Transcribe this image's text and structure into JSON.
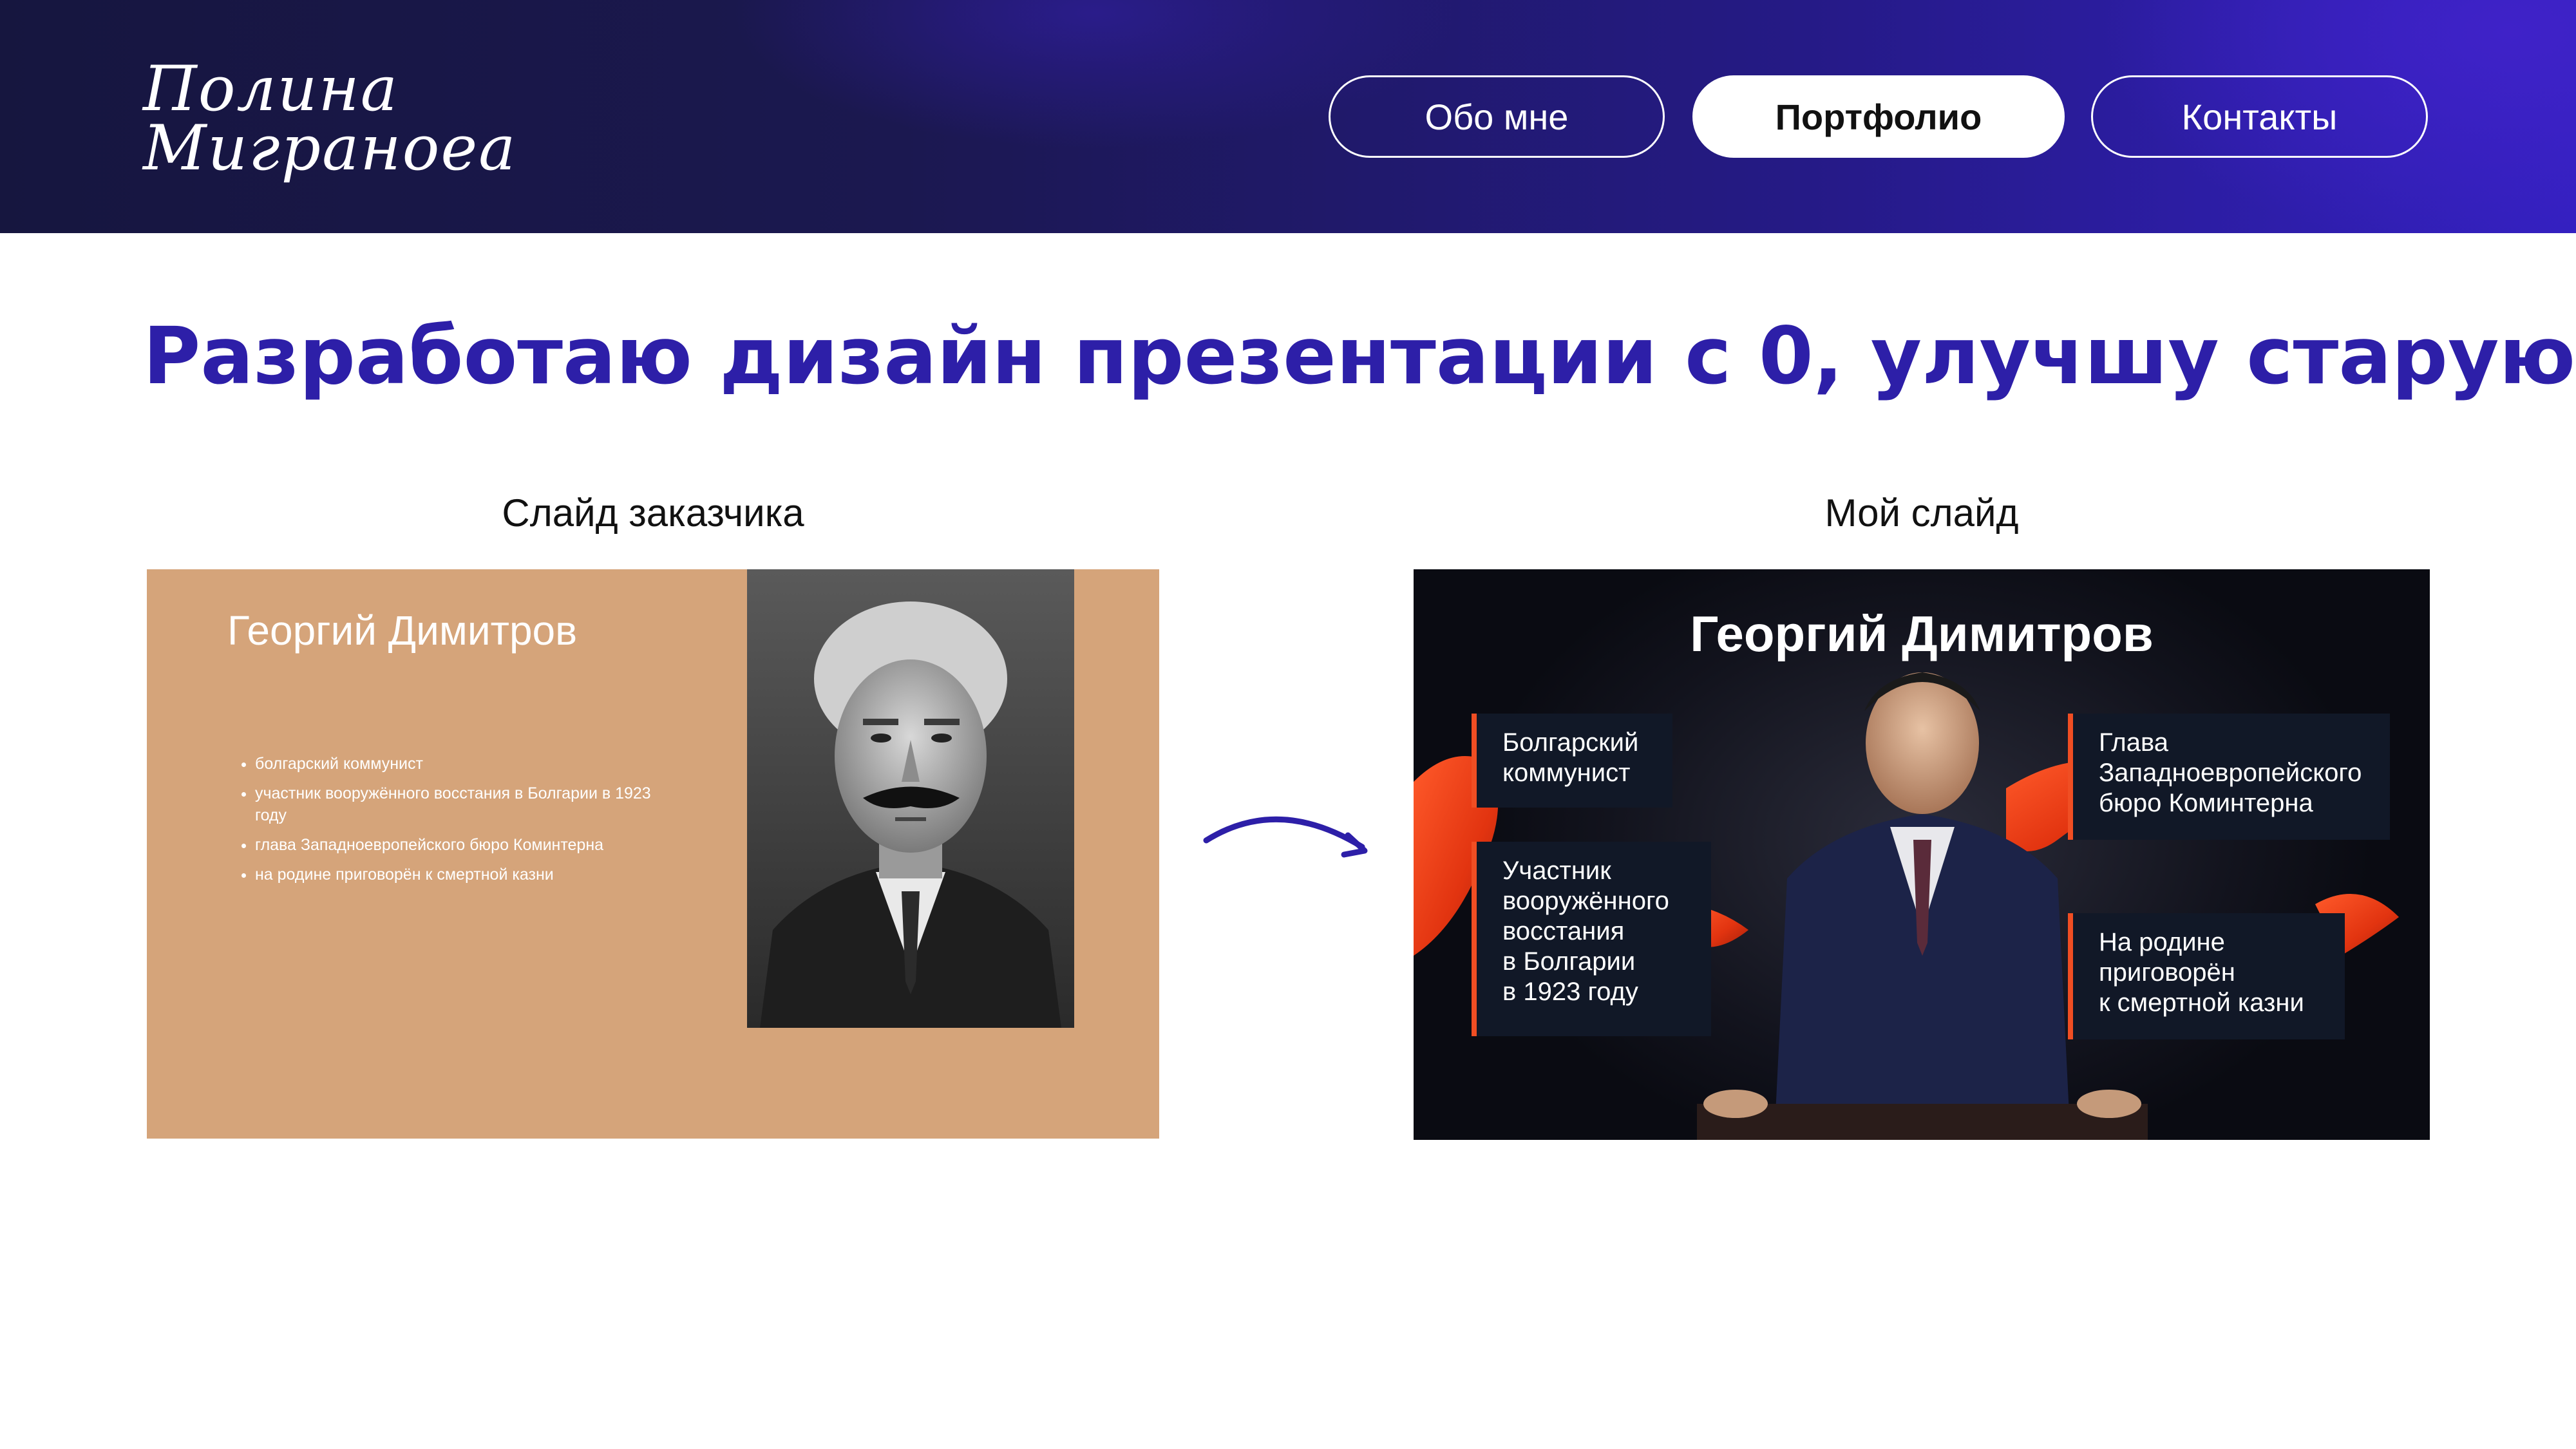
{
  "header": {
    "logo_line1": "Полина",
    "logo_line2": "Миграноеа",
    "nav": {
      "about": "Обо мне",
      "portfolio": "Портфолио",
      "contacts": "Контакты"
    },
    "active_nav": "portfolio"
  },
  "main": {
    "title": "Разработаю дизайн презентации с 0, улучшу старую",
    "caption_left": "Слайд заказчика",
    "caption_right": "Мой слайд"
  },
  "old_slide": {
    "title": "Георгий Димитров",
    "bullets": [
      "болгарский коммунист",
      "участник вооружённого восстания в Болгарии в 1923 году",
      "глава Западноевропейского бюро Коминтерна",
      "на родине приговорён к смертной казни"
    ],
    "background": "#d5a47a"
  },
  "new_slide": {
    "title": "Георгий Димитров",
    "cards": [
      "Болгарский\nкоммунист",
      "Участник\nвооружённого\nвосстания\nв Болгарии\nв 1923 году",
      "Глава\nЗападноевропейского\nбюро Коминтерна",
      "На родине\nприговорён\nк смертной казни"
    ],
    "accent": "#f04e23"
  },
  "colors": {
    "brand": "#2d1fa8",
    "header_dark": "#16163f"
  },
  "icons": {
    "transition": "curved-arrow-icon"
  }
}
